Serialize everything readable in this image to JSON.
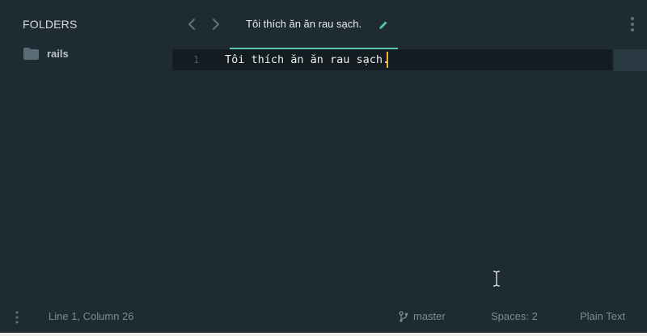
{
  "sidebar": {
    "title": "FOLDERS",
    "folders": [
      {
        "label": "rails"
      }
    ]
  },
  "tabbar": {
    "active_tab": {
      "label": "Tôi thích ăn ăn rau sạch."
    }
  },
  "editor": {
    "lines": [
      {
        "number": "1",
        "text": "Tôi thích ăn ăn rau sạch."
      }
    ]
  },
  "statusbar": {
    "position": "Line 1, Column 26",
    "branch": "master",
    "indentation": "Spaces: 2",
    "syntax": "Plain Text"
  },
  "colors": {
    "background": "#1f2b32",
    "current_line": "#141c21",
    "accent": "#55c7b3",
    "caret": "#f2b233"
  }
}
